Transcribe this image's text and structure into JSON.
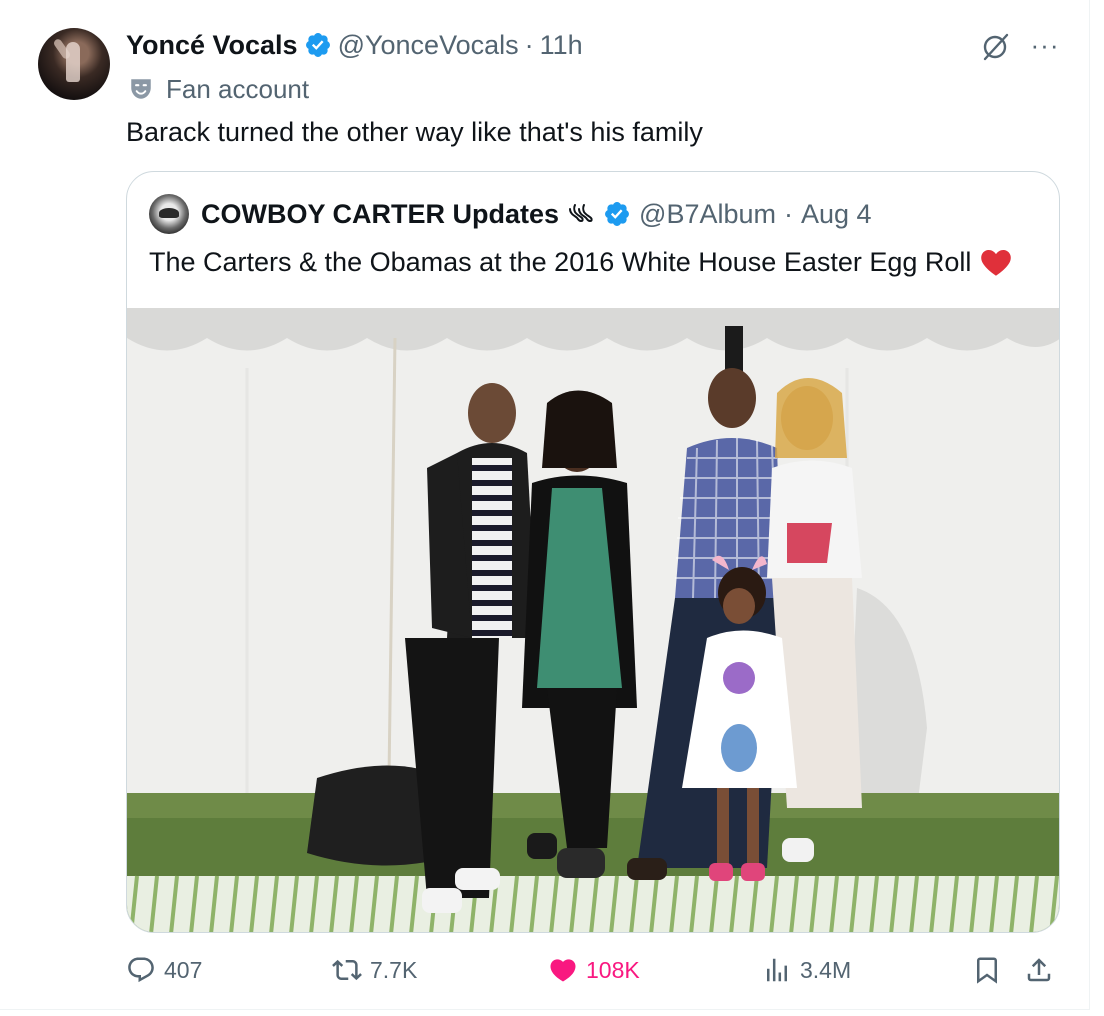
{
  "tweet": {
    "author": {
      "display_name": "Yoncé Vocals",
      "handle": "@YonceVocals",
      "time": "11h",
      "label": "Fan account"
    },
    "text": "Barack turned the other way like that's his family",
    "quoted": {
      "display_name": "COWBOY CARTER Updates",
      "handle": "@B7Album",
      "date": "Aug 4",
      "text": "The Carters & the Obamas at the 2016 White House Easter Egg Roll"
    },
    "metrics": {
      "replies": "407",
      "reposts": "7.7K",
      "likes": "108K",
      "views": "3.4M"
    },
    "separator": "·"
  },
  "colors": {
    "text_primary": "#0f1419",
    "text_secondary": "#536471",
    "verified_blue": "#1d9bf0",
    "like_pink": "#f91880",
    "border": "#cfd9de"
  },
  "icons": [
    "verified-badge-icon",
    "grok-icon",
    "more-icon",
    "fan-mask-icon",
    "reply-icon",
    "repost-icon",
    "heart-icon",
    "views-icon",
    "bookmark-icon",
    "share-icon"
  ]
}
